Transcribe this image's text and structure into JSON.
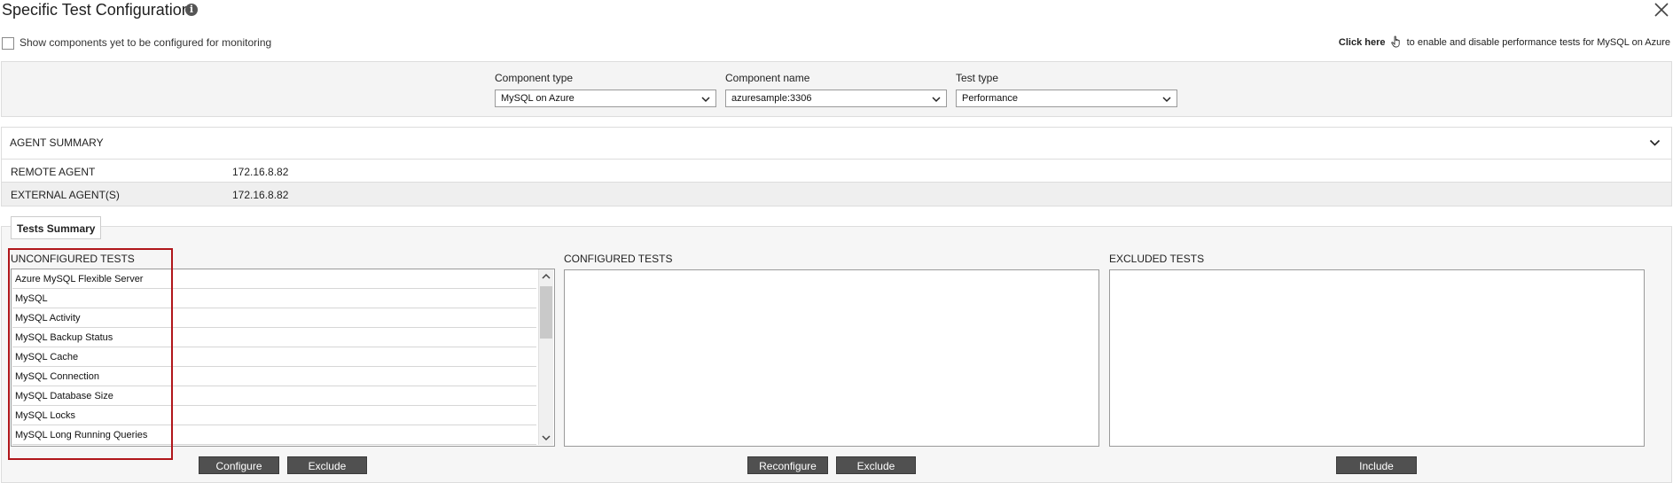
{
  "header": {
    "title": "Specific Test Configuration",
    "info_icon": "i"
  },
  "options": {
    "show_unconfigured_label": "Show components yet to be configured for monitoring",
    "show_unconfigured_checked": false,
    "click_here_label": "Click here",
    "click_here_rest": "to enable and disable performance tests for MySQL on Azure"
  },
  "filters": {
    "component_type": {
      "label": "Component type",
      "value": "MySQL on Azure"
    },
    "component_name": {
      "label": "Component name",
      "value": "azuresample:3306"
    },
    "test_type": {
      "label": "Test type",
      "value": "Performance"
    }
  },
  "agent_summary": {
    "title": "AGENT SUMMARY",
    "rows": [
      {
        "label": "REMOTE AGENT",
        "value": "172.16.8.82"
      },
      {
        "label": "EXTERNAL AGENT(S)",
        "value": "172.16.8.82"
      }
    ]
  },
  "tests_summary": {
    "tab_label": "Tests Summary",
    "unconfigured": {
      "title": "UNCONFIGURED TESTS",
      "items": [
        "Azure MySQL Flexible Server",
        "MySQL",
        "MySQL Activity",
        "MySQL Backup Status",
        "MySQL Cache",
        "MySQL Connection",
        "MySQL Database Size",
        "MySQL Locks",
        "MySQL Long Running Queries"
      ],
      "buttons": {
        "configure": "Configure",
        "exclude": "Exclude"
      }
    },
    "configured": {
      "title": "CONFIGURED TESTS",
      "buttons": {
        "reconfigure": "Reconfigure",
        "exclude": "Exclude"
      }
    },
    "excluded": {
      "title": "EXCLUDED TESTS",
      "buttons": {
        "include": "Include"
      }
    }
  },
  "colors": {
    "highlight": "#b0161b",
    "button_bg": "#505050",
    "panel_bg": "#f4f4f4"
  },
  "icons": [
    "info-icon",
    "close-icon",
    "hand-pointer-icon",
    "chevron-down-icon",
    "chevron-up-icon"
  ]
}
